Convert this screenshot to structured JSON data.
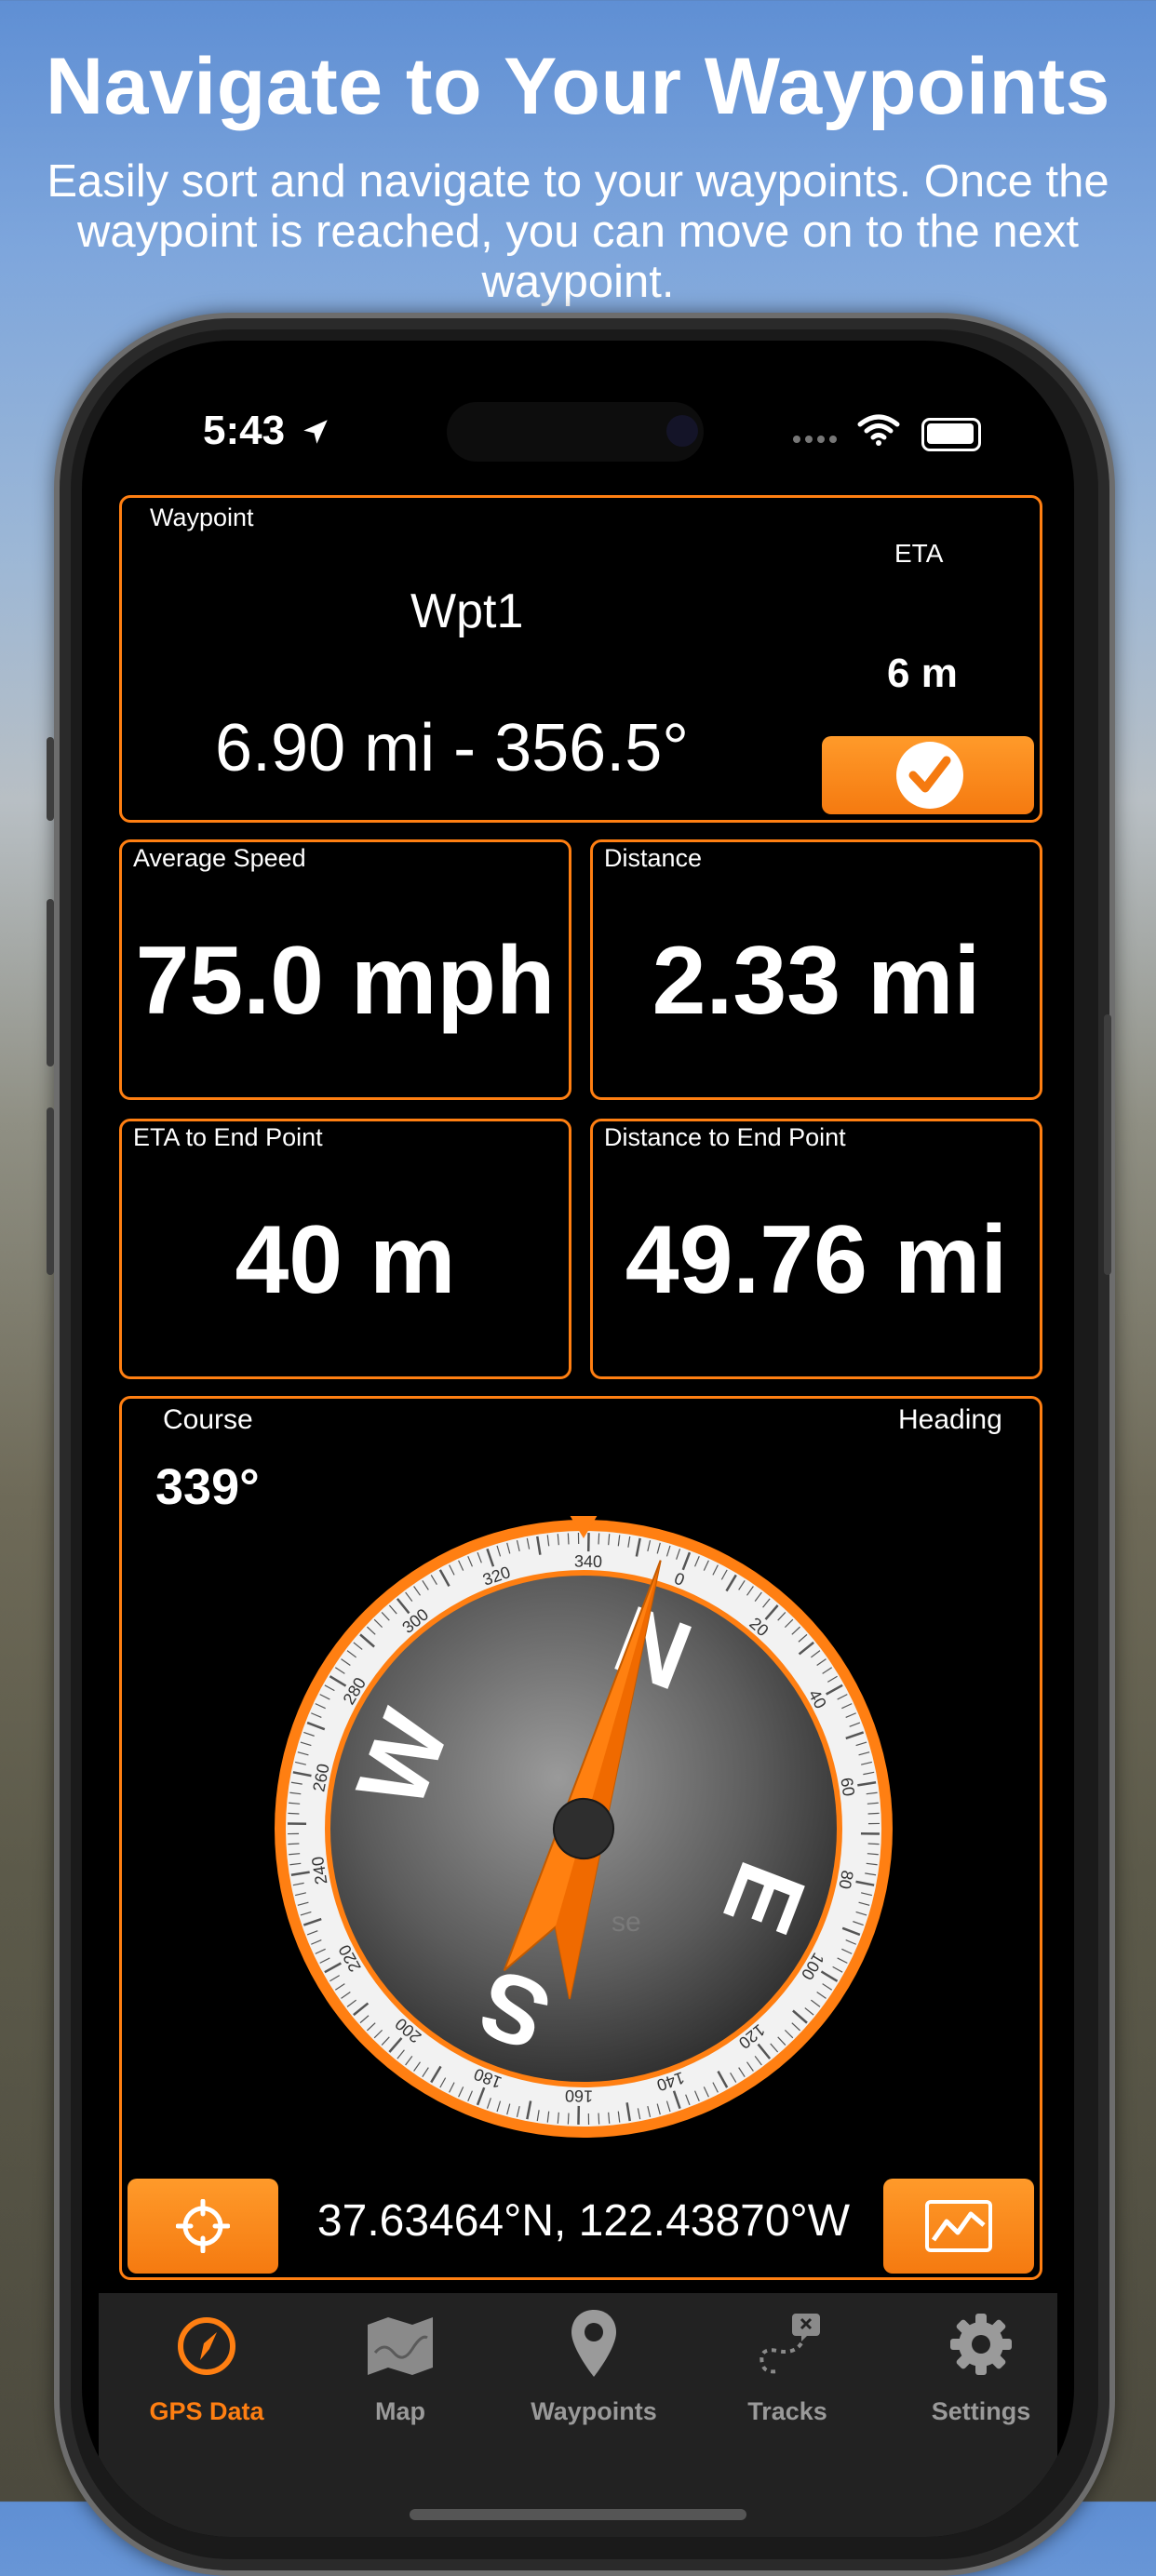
{
  "promo": {
    "title": "Navigate to Your Waypoints",
    "subtitle": "Easily sort and navigate to your waypoints. Once the waypoint is reached, you can move on to the next waypoint."
  },
  "status_bar": {
    "time": "5:43"
  },
  "waypoint_panel": {
    "label": "Waypoint",
    "name": "Wpt1",
    "distance_bearing": "6.90 mi - 356.5°",
    "eta_label": "ETA",
    "eta_value": "6 m"
  },
  "stats": {
    "average_speed": {
      "label": "Average Speed",
      "value": "75.0 mph"
    },
    "distance": {
      "label": "Distance",
      "value": "2.33 mi"
    },
    "eta_end": {
      "label": "ETA to End Point",
      "value": "40 m"
    },
    "distance_end": {
      "label": "Distance to End Point",
      "value": "49.76 mi"
    }
  },
  "compass_panel": {
    "course_label": "Course",
    "course_value": "339°",
    "heading_label": "Heading",
    "cardinals": [
      "N",
      "E",
      "S",
      "W"
    ],
    "faded_text": "se",
    "bezel_ticks": [
      "0",
      "20",
      "40",
      "60",
      "80",
      "100",
      "120",
      "140",
      "160",
      "180",
      "200",
      "220",
      "240",
      "260",
      "280",
      "300",
      "320",
      "340"
    ],
    "needle_heading_deg": 16,
    "bezel_rotation_deg": 21,
    "coordinates": "37.63464°N, 122.43870°W"
  },
  "tabs": [
    {
      "label": "GPS Data",
      "active": true,
      "icon": "compass-icon"
    },
    {
      "label": "Map",
      "active": false,
      "icon": "map-icon"
    },
    {
      "label": "Waypoints",
      "active": false,
      "icon": "pin-icon"
    },
    {
      "label": "Tracks",
      "active": false,
      "icon": "route-icon"
    },
    {
      "label": "Settings",
      "active": false,
      "icon": "gear-icon"
    }
  ],
  "colors": {
    "accent": "#ff7f12",
    "tab_active": "#ff7f12",
    "tab_inactive": "#9a9a9a"
  }
}
